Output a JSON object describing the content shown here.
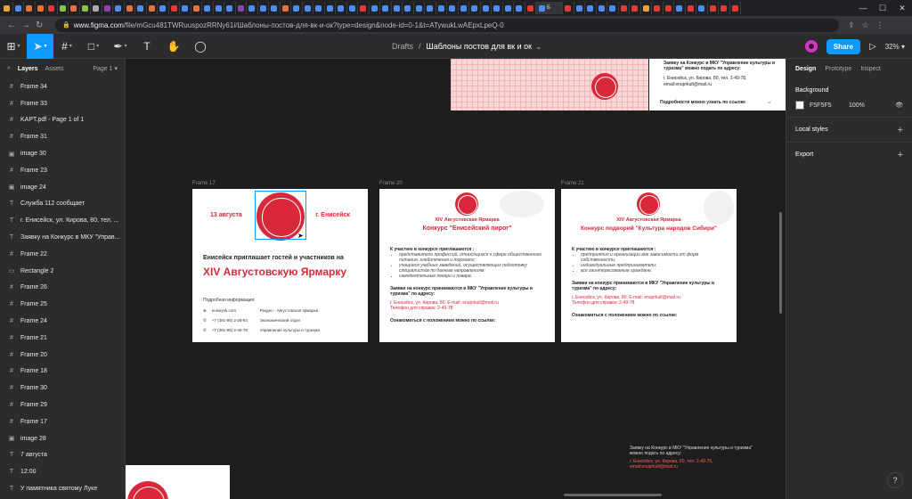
{
  "browser": {
    "active_tab": "Б",
    "tab_colors": [
      "#e8a33d",
      "#4c8df6",
      "#e8713d",
      "#f47421",
      "#e53935",
      "#8bc34a",
      "#e8713d",
      "#8bc34a",
      "#aaaaaa",
      "#8e44ad",
      "#4c8df6",
      "#e8713d",
      "#4c8df6",
      "#e8713d",
      "#4c8df6",
      "#e53935",
      "#4c8df6",
      "#e8713d",
      "#4c8df6",
      "#4c8df6",
      "#4c8df6",
      "#8e44ad",
      "#4c8df6",
      "#4c8df6",
      "#4c8df6",
      "#e8713d",
      "#4c8df6",
      "#4c8df6",
      "#4c8df6",
      "#4c8df6",
      "#4c8df6",
      "#4c8df6",
      "#e53935",
      "#4c8df6",
      "#4c8df6",
      "#4c8df6",
      "#4c8df6",
      "#4c8df6",
      "#4c8df6",
      "#4c8df6",
      "#4c8df6",
      "#4c8df6",
      "#4c8df6",
      "#4c8df6",
      "#4c8df6",
      "#4c8df6",
      "#4c8df6",
      "#e53935",
      "#4c8df6",
      "#e53935",
      "#4c8df6",
      "#4c8df6",
      "#4c8df6",
      "#4c8df6",
      "#e53935",
      "#e53935",
      "#e8a33d",
      "#e53935",
      "#e53935",
      "#4c8df6",
      "#e53935",
      "#4c8df6",
      "#e53935",
      "#e53935",
      "#e53935"
    ],
    "url_host": "www.figma.com",
    "url_path": "/file/mGcu481TWRuuspozRRNy61i/Шаблоны-постов-для-вк-и-ок?type=design&node-id=0-1&t=ATywukLwAEpxLpeQ-0"
  },
  "toolbar": {
    "drafts": "Drafts",
    "file_name": "Шаблоны постов для вк и ок",
    "share": "Share",
    "zoom": "32%"
  },
  "layers_panel": {
    "tab_layers": "Layers",
    "tab_assets": "Assets",
    "page": "Page 1",
    "items": [
      {
        "icon": "#",
        "name": "Frame 34"
      },
      {
        "icon": "#",
        "name": "Frame 33"
      },
      {
        "icon": "#",
        "name": "KAPT.pdf - Page 1 of 1"
      },
      {
        "icon": "#",
        "name": "Frame 31"
      },
      {
        "icon": "▣",
        "name": "image 30"
      },
      {
        "icon": "#",
        "name": "Frame 23"
      },
      {
        "icon": "▣",
        "name": "image 24"
      },
      {
        "icon": "T",
        "name": "Служба 112 сообщает"
      },
      {
        "icon": "T",
        "name": "г. Енисейск, ул. Кирова, 80, тел. ..."
      },
      {
        "icon": "T",
        "name": "Заявку на Конкурс в МКУ \"Управ..."
      },
      {
        "icon": "#",
        "name": "Frame 22"
      },
      {
        "icon": "▭",
        "name": "Rectangle 2"
      },
      {
        "icon": "#",
        "name": "Frame 26"
      },
      {
        "icon": "#",
        "name": "Frame 25"
      },
      {
        "icon": "#",
        "name": "Frame 24"
      },
      {
        "icon": "#",
        "name": "Frame 21"
      },
      {
        "icon": "#",
        "name": "Frame 20"
      },
      {
        "icon": "#",
        "name": "Frame 18"
      },
      {
        "icon": "#",
        "name": "Frame 30"
      },
      {
        "icon": "#",
        "name": "Frame 29"
      },
      {
        "icon": "#",
        "name": "Frame 17"
      },
      {
        "icon": "▣",
        "name": "image 28"
      },
      {
        "icon": "T",
        "name": "7 августа"
      },
      {
        "icon": "T",
        "name": "12:00"
      },
      {
        "icon": "T",
        "name": "У памятника святому Луке"
      }
    ]
  },
  "design_panel": {
    "tab_design": "Design",
    "tab_prototype": "Prototype",
    "tab_inspect": "Inspect",
    "background_label": "Background",
    "bg_hex": "F5F5F5",
    "bg_opacity": "100%",
    "local_styles": "Local styles",
    "export": "Export"
  },
  "canvas": {
    "top_frame": {
      "line1": "Заявку на Конкурс в МКУ \"Управление культуры и туризма\" можно подать по адресу:",
      "line2": "г. Енисейск, ул. Кирова, 80, тел. 2-49-78,",
      "line3": "email:enuprkult@mail.ru",
      "line4": "Подробности можно узнать по ссылке"
    },
    "frame17": {
      "label": "Frame 17",
      "date": "13 августа",
      "city": "г. Енисейск",
      "invite": "Енисейск приглашает гостей и участников на",
      "fair": "XIV Августовскую Ярмарку",
      "more": "Подробная информация:",
      "rows": [
        {
          "a": "eniseysk.com",
          "b": "Раздел - Августовская ярмарка"
        },
        {
          "a": "+7 (391-95) 2-28-84",
          "b": "Экономический отдел"
        },
        {
          "a": "+7 (391-95) 2-49-78",
          "b": "Управление культуры и туризма"
        }
      ]
    },
    "frame20": {
      "label": "Frame 20",
      "subtitle": "XIV Августовская Ярмарка",
      "title": "Конкурс \"Енисейский пирог\"",
      "intro": "К участию в конкурсе приглашаются :",
      "items": [
        "представители профессий, относящихся к сфере общественного питания, хлебопечения и торговли;",
        "учащиеся учебных заведений, осуществляющих подготовку специалистов по данным направлениям;",
        "самодеятельные пекари и повара."
      ],
      "apply": "Заявки на конкурс принимаются в МКУ \"Управление культуры и туризма\" по адресу:",
      "addr": "г. Енисейск, ул. Кирова, 80. E-mail: enuprkult@mail.ru",
      "phone": "Телефон для справок: 2-49-78",
      "link": "Ознакомиться с положением можно по ссылке:"
    },
    "frame21": {
      "label": "Frame 21",
      "subtitle": "XIV Августовская Ярмарка",
      "title": "Конкурс подворий \"Культура народов Сибири\"",
      "intro": "К участию в конкурсе приглашаются :",
      "items": [
        "предприятия и организации вне зависимости от форм собственности;",
        "индивидуальные предприниматели;",
        "все заинтересованные граждане."
      ],
      "apply": "Заявки на конкурс принимаются в МКУ \"Управление культуры и туризма\" по адресу:",
      "addr": "г. Енисейск, ул. Кирова, 80. E-mail: enuprkult@mail.ru",
      "phone": "Телефон для справок: 2-49-78",
      "link": "Ознакомиться с положением можно по ссылке:"
    },
    "bottom_text": {
      "line1": "Заявку на Конкурс в МКУ \"Управление культуры и туризма\" можно подать по адресу:",
      "line2": "г. Енисейск, ул. Кирова, 80, тел. 2-49-78,",
      "line3": "email:enuprkult@mail.ru"
    }
  },
  "help": "?"
}
